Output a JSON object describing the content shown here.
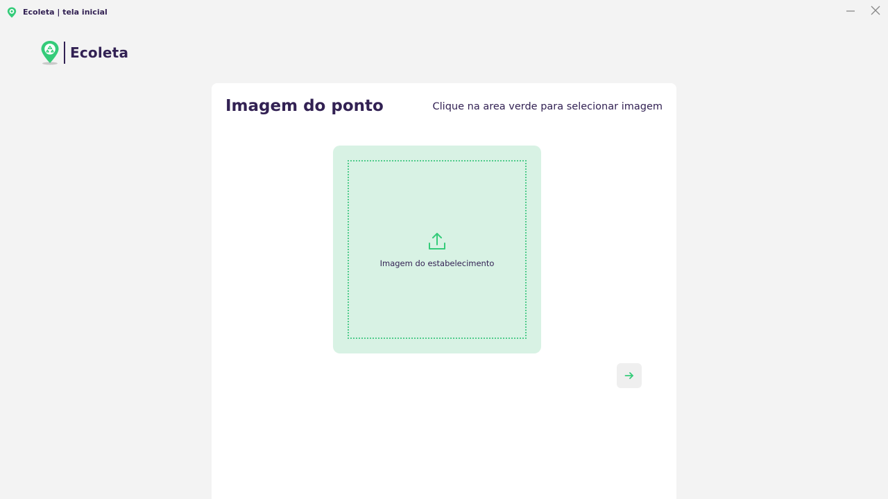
{
  "window": {
    "title": "Ecoleta | tela inicial"
  },
  "header": {
    "brand": "Ecoleta"
  },
  "card": {
    "heading": "Imagem do ponto",
    "hint": "Clique na area verde para selecionar imagem",
    "dropzone_label": "Imagem do estabelecimento"
  },
  "icons": {
    "app": "map-pin-recycle-icon",
    "minimize": "minimize-icon",
    "close": "close-icon",
    "upload": "upload-icon",
    "next": "arrow-right-icon"
  },
  "colors": {
    "brand_green": "#34cb79",
    "text_dark": "#322153",
    "dropzone_bg": "#d8f2e4",
    "background": "#f3f3f3"
  }
}
